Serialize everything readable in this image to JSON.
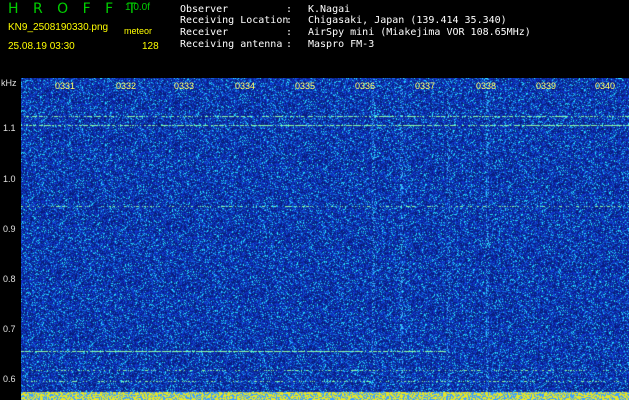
{
  "header": {
    "app_name": "H R O F F T",
    "version": "1.0.0f",
    "filename": "KN9_2508190330.png",
    "mode": "meteor",
    "timestamp": "25.08.19 03:30",
    "count": "128",
    "meta": [
      {
        "label": "Observer",
        "colon": ":",
        "value": "K.Nagai"
      },
      {
        "label": "Receiving Location",
        "colon": ":",
        "value": "Chigasaki, Japan (139.414 35.340)"
      },
      {
        "label": "Receiver",
        "colon": ":",
        "value": "AirSpy mini (Miakejima VOR 108.65MHz)"
      },
      {
        "label": "Receiving antenna",
        "colon": ":",
        "value": "Maspro FM-3"
      }
    ]
  },
  "axis": {
    "y_unit": "kHz",
    "y_ticks": [
      "1.1",
      "1.0",
      "0.9",
      "0.8",
      "0.7",
      "0.6"
    ],
    "x_ticks": [
      "0331",
      "0332",
      "0333",
      "0334",
      "0335",
      "0336",
      "0337",
      "0338",
      "0339",
      "0340"
    ]
  },
  "colors": {
    "background_noise": "#1030b0",
    "signal": "#80ffa0",
    "label_yellow": "#ffff00",
    "label_green": "#00d000"
  }
}
